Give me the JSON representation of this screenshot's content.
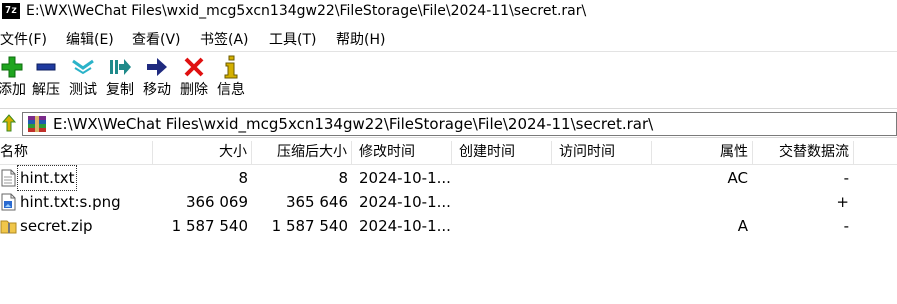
{
  "window": {
    "app_icon_text": "7z",
    "title": "E:\\WX\\WeChat Files\\wxid_mcg5xcn134gw22\\FileStorage\\File\\2024-11\\secret.rar\\"
  },
  "menu": [
    {
      "label": "文件(F)"
    },
    {
      "label": "编辑(E)"
    },
    {
      "label": "查看(V)"
    },
    {
      "label": "书签(A)"
    },
    {
      "label": "工具(T)"
    },
    {
      "label": "帮助(H)"
    }
  ],
  "toolbar": [
    {
      "label": "添加",
      "icon": "add-icon",
      "color": "#1fa51f"
    },
    {
      "label": "解压",
      "icon": "extract-icon",
      "color": "#1f3a9f"
    },
    {
      "label": "测试",
      "icon": "test-icon",
      "color": "#2bb3c9"
    },
    {
      "label": "复制",
      "icon": "copy-icon",
      "color": "#1f8a8a"
    },
    {
      "label": "移动",
      "icon": "move-icon",
      "color": "#1f2a7f"
    },
    {
      "label": "删除",
      "icon": "delete-icon",
      "color": "#e01010"
    },
    {
      "label": "信息",
      "icon": "info-icon",
      "color": "#d4b000"
    }
  ],
  "address": {
    "path": "E:\\WX\\WeChat Files\\wxid_mcg5xcn134gw22\\FileStorage\\File\\2024-11\\secret.rar\\"
  },
  "columns": {
    "name": "名称",
    "size": "大小",
    "packed": "压缩后大小",
    "modified": "修改时间",
    "created": "创建时间",
    "accessed": "访问时间",
    "attributes": "属性",
    "alt_streams": "交替数据流"
  },
  "files": [
    {
      "name": "hint.txt",
      "size": "8",
      "packed": "8",
      "modified": "2024-10-1...",
      "created": "",
      "accessed": "",
      "attributes": "AC",
      "alt_streams": "-",
      "icon": "text-file-icon"
    },
    {
      "name": "hint.txt:s.png",
      "size": "366 069",
      "packed": "365 646",
      "modified": "2024-10-1...",
      "created": "",
      "accessed": "",
      "attributes": "",
      "alt_streams": "+",
      "icon": "image-file-icon"
    },
    {
      "name": "secret.zip",
      "size": "1 587 540",
      "packed": "1 587 540",
      "modified": "2024-10-1...",
      "created": "",
      "accessed": "",
      "attributes": "A",
      "alt_streams": "-",
      "icon": "zip-folder-icon"
    }
  ]
}
